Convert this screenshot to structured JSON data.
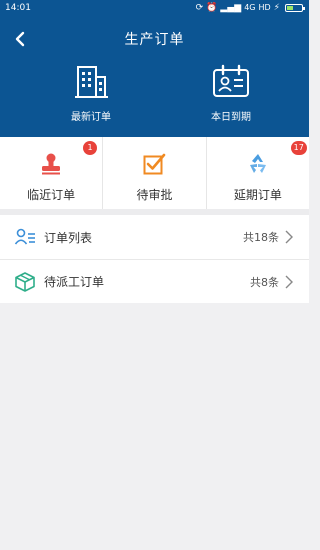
{
  "status_bar": {
    "time": "14:01",
    "network": "4G",
    "hd": "HD"
  },
  "header": {
    "title": "生产订单",
    "back_icon": "chevron-left-icon",
    "items": [
      {
        "icon": "building-icon",
        "label": "最新订单"
      },
      {
        "icon": "id-card-icon",
        "label": "本日到期"
      }
    ]
  },
  "quick_actions": [
    {
      "icon": "stamp-icon",
      "label": "临近订单",
      "badge": "1",
      "color": "#e8504a"
    },
    {
      "icon": "checkbox-icon",
      "label": "待审批",
      "badge": null,
      "color": "#f08a22"
    },
    {
      "icon": "recycle-icon",
      "label": "延期订单",
      "badge": "17",
      "color": "#4a9de0"
    }
  ],
  "list": [
    {
      "icon": "user-list-icon",
      "label": "订单列表",
      "count": "共18条"
    },
    {
      "icon": "box-icon",
      "label": "待派工订单",
      "count": "共8条"
    }
  ],
  "colors": {
    "header_bg": "#0c5593",
    "badge": "#e8423a",
    "page_bg": "#f0f0f2"
  }
}
